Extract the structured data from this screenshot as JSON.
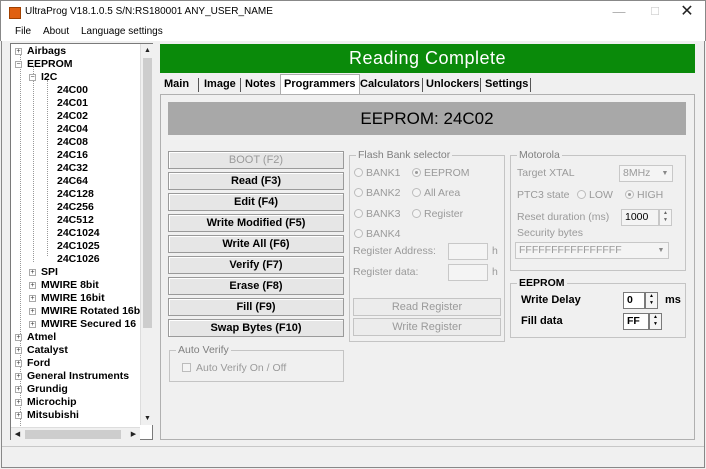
{
  "window": {
    "title": "UltraProg V18.1.0.5 S/N:RS180001 ANY_USER_NAME",
    "minimize": "—",
    "maximize": "☐",
    "close": "✕"
  },
  "menu": [
    "File",
    "About",
    "Language settings"
  ],
  "tree": [
    {
      "label": "Airbags",
      "exp": "+"
    },
    {
      "label": "EEPROM",
      "exp": "−"
    },
    {
      "label": "I2C",
      "exp": "−"
    },
    {
      "label": "24C00"
    },
    {
      "label": "24C01"
    },
    {
      "label": "24C02"
    },
    {
      "label": "24C04"
    },
    {
      "label": "24C08"
    },
    {
      "label": "24C16"
    },
    {
      "label": "24C32"
    },
    {
      "label": "24C64"
    },
    {
      "label": "24C128"
    },
    {
      "label": "24C256"
    },
    {
      "label": "24C512"
    },
    {
      "label": "24C1024"
    },
    {
      "label": "24C1025"
    },
    {
      "label": "24C1026"
    },
    {
      "label": "SPI",
      "exp": "+"
    },
    {
      "label": "MWIRE 8bit",
      "exp": "+"
    },
    {
      "label": "MWIRE 16bit",
      "exp": "+"
    },
    {
      "label": "MWIRE Rotated 16b",
      "exp": "+"
    },
    {
      "label": "MWIRE Secured 16",
      "exp": "+"
    },
    {
      "label": "Atmel",
      "exp": "+"
    },
    {
      "label": "Catalyst",
      "exp": "+"
    },
    {
      "label": "Ford",
      "exp": "+"
    },
    {
      "label": "General Instruments",
      "exp": "+"
    },
    {
      "label": "Grundig",
      "exp": "+"
    },
    {
      "label": "Microchip",
      "exp": "+"
    },
    {
      "label": "Mitsubishi",
      "exp": "+"
    }
  ],
  "status_banner": "Reading  Complete",
  "tabs": [
    "Main",
    "Image",
    "Notes",
    "Programmers",
    "Calculators",
    "Unlockers",
    "Settings"
  ],
  "active_tab": "Programmers",
  "device_header": "EEPROM: 24C02",
  "buttons": {
    "boot": "BOOT (F2)",
    "read": "Read (F3)",
    "edit": "Edit (F4)",
    "write_modified": "Write Modified (F5)",
    "write_all": "Write All (F6)",
    "verify": "Verify (F7)",
    "erase": "Erase (F8)",
    "fill": "Fill (F9)",
    "swap_bytes": "Swap Bytes (F10)"
  },
  "auto_verify": {
    "title": "Auto Verify",
    "checkbox_label": "Auto Verify On / Off"
  },
  "flash_bank": {
    "title": "Flash Bank selector",
    "bank1": "BANK1",
    "eeprom": "EEPROM",
    "bank2": "BANK2",
    "all_area": "All Area",
    "bank3": "BANK3",
    "register": "Register",
    "bank4": "BANK4",
    "register_address_label": "Register Address:",
    "register_address_value": "",
    "register_data_label": "Register data:",
    "register_data_value": "",
    "hex_suffix": "h",
    "read_register": "Read Register",
    "write_register": "Write Register"
  },
  "motorola": {
    "title": "Motorola",
    "target_xtal_label": "Target XTAL",
    "target_xtal_value": "8MHz",
    "ptc3_label": "PTC3 state",
    "ptc3_low": "LOW",
    "ptc3_high": "HIGH",
    "reset_duration_label": "Reset duration (ms)",
    "reset_duration_value": "1000",
    "security_bytes_label": "Security bytes",
    "security_bytes_value": "FFFFFFFFFFFFFFFF"
  },
  "eeprom_settings": {
    "title": "EEPROM",
    "write_delay_label": "Write Delay",
    "write_delay_value": "0",
    "write_delay_unit": "ms",
    "fill_data_label": "Fill data",
    "fill_data_value": "FF"
  },
  "icons": {
    "spin_up": "▲",
    "spin_down": "▼",
    "dropdown": "▼",
    "scroll_up": "▲",
    "scroll_down": "▼",
    "scroll_left": "◀",
    "scroll_right": "▶"
  },
  "colors": {
    "banner": "#0a8a0a",
    "header_bar": "#a8a8a8"
  }
}
